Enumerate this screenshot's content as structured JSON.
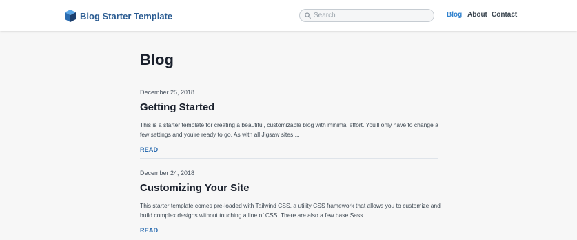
{
  "header": {
    "brand_title": "Blog Starter Template",
    "search": {
      "placeholder": "Search",
      "value": ""
    },
    "nav": [
      {
        "label": "Blog",
        "active": true
      },
      {
        "label": "About",
        "active": false
      },
      {
        "label": "Contact",
        "active": false
      }
    ]
  },
  "main": {
    "page_title": "Blog",
    "posts": [
      {
        "date": "December 25, 2018",
        "title": "Getting Started",
        "excerpt": "This is a starter template for creating a beautiful, customizable blog with minimal effort. You'll only have to change a few settings and you're ready to go. As with all Jigsaw sites,...",
        "read_label": "READ"
      },
      {
        "date": "December 24, 2018",
        "title": "Customizing Your Site",
        "excerpt": "This starter template comes pre-loaded with Tailwind CSS, a utility CSS framework that allows you to customize and build complex designs without touching a line of CSS. There are also a few base Sass...",
        "read_label": "READ"
      }
    ]
  },
  "colors": {
    "brand": "#2b5c92",
    "nav_active": "#3182ce",
    "link": "#2b6cb0",
    "background": "#f7f7f7"
  },
  "icons": {
    "logo": "cube-logo-icon",
    "search": "search-icon"
  }
}
